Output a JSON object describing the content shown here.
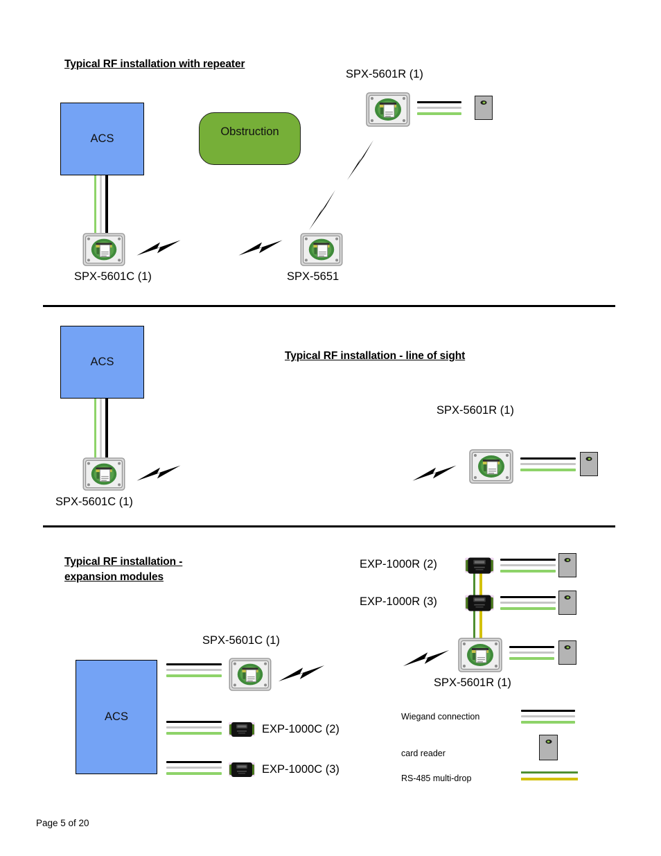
{
  "document": {
    "footer": "Page 5 of 20"
  },
  "sections": [
    {
      "id": "repeater",
      "title": "Typical RF installation with repeater",
      "nodes": {
        "acs": "ACS",
        "obstruction": "Obstruction",
        "repeater_label": "SPX-5601R (1)",
        "controller_label": "SPX-5601C (1)",
        "relay_label": "SPX-5651"
      }
    },
    {
      "id": "line-of-sight",
      "title": "Typical RF installation - line of sight",
      "nodes": {
        "acs": "ACS",
        "controller_label": "SPX-5601C (1)",
        "remote_label": "SPX-5601R (1)"
      }
    },
    {
      "id": "expansion-modules",
      "title": "Typical RF installation - expansion modules",
      "nodes": {
        "acs": "ACS",
        "controller_label": "SPX-5601C (1)",
        "exp_c_2": "EXP-1000C (2)",
        "exp_c_3": "EXP-1000C (3)",
        "exp_r_2": "EXP-1000R (2)",
        "exp_r_3": "EXP-1000R (3)",
        "remote_label": "SPX-5601R (1)"
      }
    }
  ],
  "legend": {
    "items": [
      {
        "label": "Wiegand connection",
        "symbol": "wiegand-cable"
      },
      {
        "label": "card reader",
        "symbol": "card-reader"
      },
      {
        "label": "RS-485 multi-drop",
        "symbol": "rs485-cable"
      }
    ]
  },
  "colors": {
    "acs_fill": "#74a3f5",
    "obstruction_fill": "#76af38",
    "reader_fill": "#b4b4b4",
    "wiegand_black": "#000000",
    "wiegand_gray": "#c6c6c6",
    "wiegand_green": "#8ed369",
    "rs485_green": "#4f8f31",
    "rs485_yellow": "#d3c10c"
  }
}
